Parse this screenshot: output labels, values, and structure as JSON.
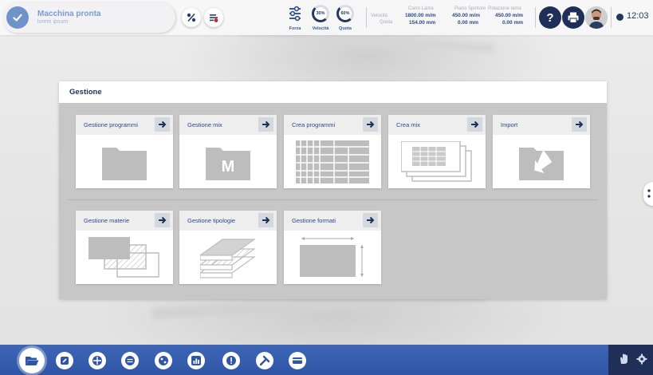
{
  "status": {
    "title": "Macchina pronta",
    "subtitle": "lorem ipsum"
  },
  "top_controls": {
    "forza_label": "Forza",
    "velocita_label": "Velocità",
    "velocita_value": "30%",
    "quota_label": "Quota",
    "quota_value": "60%"
  },
  "readings": {
    "row_labels": {
      "velocita": "Velocità",
      "quota": "Quota"
    },
    "columns": [
      {
        "header": "Carro Lama",
        "velocita": "1800.00 m/m",
        "quota": "154.00 mm"
      },
      {
        "header": "Piano Spintore",
        "velocita": "450.00 m/m",
        "quota": "0.00 mm"
      },
      {
        "header": "Rotazione lama",
        "velocita": "450.00 m/m",
        "quota": "0.00 mm"
      }
    ]
  },
  "clock": {
    "time": "12:03"
  },
  "panel": {
    "title": "Gestione",
    "row1": [
      {
        "label": "Gestione programmi",
        "icon": "folder-icon"
      },
      {
        "label": "Gestione mix",
        "icon": "folder-m-icon"
      },
      {
        "label": "Crea programmi",
        "icon": "grid-table-icon"
      },
      {
        "label": "Crea mix",
        "icon": "stacked-sheets-icon"
      },
      {
        "label": "Import",
        "icon": "folder-import-icon"
      }
    ],
    "row2": [
      {
        "label": "Gestione materie",
        "icon": "materials-icon"
      },
      {
        "label": "Gestione tipologie",
        "icon": "layers-icon"
      },
      {
        "label": "Gestione formati",
        "icon": "format-dimensions-icon"
      }
    ]
  },
  "colors": {
    "accent": "#2c4a86",
    "dark": "#1f2f58",
    "bottombar": "#3a60b0",
    "status": "#6f93c9"
  },
  "bottom_nav": [
    "folder-icon",
    "edit-icon",
    "move-icon",
    "transfer-icon",
    "stats-icon",
    "chart-icon",
    "alert-icon",
    "tools-icon",
    "card-icon"
  ]
}
